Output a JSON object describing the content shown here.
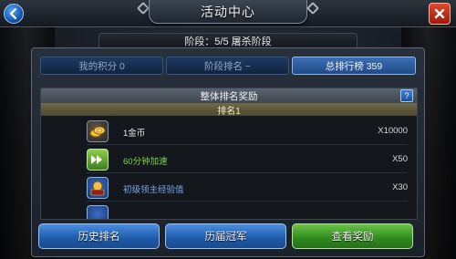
{
  "header": {
    "title": "活动中心",
    "back_icon": "back-arrow-icon",
    "close_icon": "close-icon"
  },
  "stage_info": "阶段：5/5 屠杀阶段",
  "tabs": [
    {
      "label": "我的积分 0",
      "active": false
    },
    {
      "label": "阶段排名 ~",
      "active": false
    },
    {
      "label": "总排行榜 359",
      "active": true
    }
  ],
  "reward_panel": {
    "title": "整体排名奖励",
    "help_label": "?",
    "rank_label": "排名1",
    "items": [
      {
        "icon": "gold-coin-icon",
        "name": "1金币",
        "qty": "X10000",
        "color": "#e6e6e6"
      },
      {
        "icon": "speed-up-icon",
        "name": "60分钟加速",
        "qty": "X50",
        "color": "#7fd444"
      },
      {
        "icon": "exp-icon",
        "name": "初级领主经验值",
        "qty": "X30",
        "color": "#79a9ef"
      }
    ]
  },
  "buttons": {
    "history_rank": "历史排名",
    "past_champions": "历届冠军",
    "view_rewards": "查看奖励"
  },
  "colors": {
    "tab_active": "#3e6fb5",
    "tab_inactive": "#1d3a63",
    "button_blue": "#1e5aa8",
    "button_green": "#2f8a1f",
    "close_red": "#c53a22"
  }
}
